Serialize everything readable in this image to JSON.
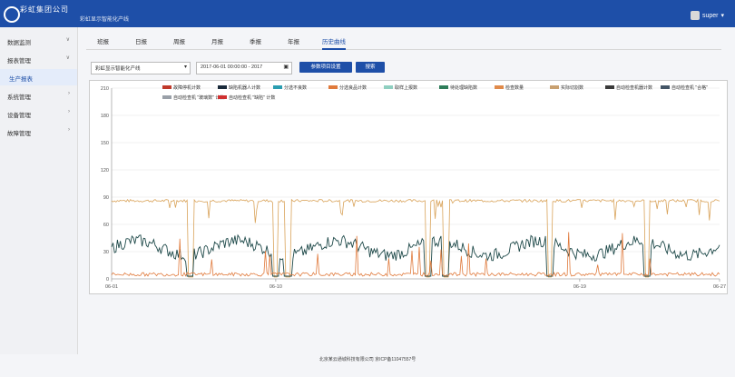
{
  "header": {
    "company": "彩虹集团公司",
    "system_name": "彩虹显示智能化产线",
    "user": "super"
  },
  "sidebar": {
    "items": [
      {
        "label": "数据监测",
        "caret": "∨"
      },
      {
        "label": "报表管理",
        "caret": "∨"
      },
      {
        "label": "生产报表",
        "caret": ""
      },
      {
        "label": "系统管理",
        "caret": "›"
      },
      {
        "label": "设备管理",
        "caret": "›"
      },
      {
        "label": "故障管理",
        "caret": "›"
      }
    ]
  },
  "tabs": [
    "班报",
    "日报",
    "周报",
    "月报",
    "季报",
    "年报",
    "历史曲线"
  ],
  "filters": {
    "line_select": "彩虹显示智能化产线",
    "date_range": "2017-06-01 00:00:00 - 2017",
    "select_button": "参数项目设置",
    "search_button": "搜索"
  },
  "chart_data": {
    "type": "line",
    "y_ticks": [
      "0",
      "30",
      "60",
      "90",
      "120",
      "150",
      "180",
      "210"
    ],
    "ylim": [
      0,
      210
    ],
    "x_ticks": [
      "06-01",
      "06-10",
      "06-19",
      "06-27"
    ],
    "legend": [
      {
        "name": "故障停机计数",
        "color": "#c0392b"
      },
      {
        "name": "缺陷机器人计数",
        "color": "#1a2a3a"
      },
      {
        "name": "分选不良数",
        "color": "#2a9db0"
      },
      {
        "name": "分选良品计数",
        "color": "#e07a3c"
      },
      {
        "name": "取样上报数",
        "color": "#8fcfc0"
      },
      {
        "name": "待处理缺陷数",
        "color": "#2e7d5a"
      },
      {
        "name": "检查数量",
        "color": "#e08a4a"
      },
      {
        "name": "实际切割数",
        "color": "#c8a070"
      },
      {
        "name": "自动检查机器计数",
        "color": "#3a3a3a"
      },
      {
        "name": "自动检查机 \"合格\"",
        "color": "#445566"
      },
      {
        "name": "自动检查机 \"玻璃数\" 计数",
        "color": "#9aa0a8"
      },
      {
        "name": "自动检查机 \"缺陷\" 计数",
        "color": "#d03030"
      }
    ],
    "series": [
      {
        "name": "实际切割数",
        "color": "#d9a35a",
        "baseline": 86
      },
      {
        "name": "缺陷机器人计数",
        "color": "#1f4a4a",
        "baseline": 34
      },
      {
        "name": "分选良品计数",
        "color": "#e07a3c",
        "baseline": 3
      }
    ]
  },
  "footer": {
    "text": "北京某云通城科技有限公司 京ICP备11047557号"
  }
}
